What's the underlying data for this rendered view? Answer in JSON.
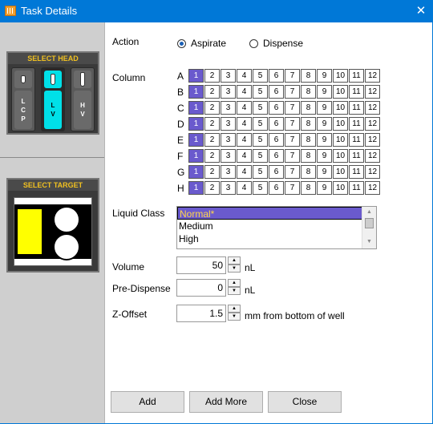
{
  "window": {
    "title": "Task Details",
    "close_glyph": "✕"
  },
  "sidebar": {
    "head_panel_title": "SELECT HEAD",
    "target_panel_title": "SELECT TARGET",
    "heads": [
      {
        "letters": [
          "L",
          "C",
          "P"
        ],
        "selected": false
      },
      {
        "letters": [
          "L",
          "V"
        ],
        "selected": true
      },
      {
        "letters": [
          "H",
          "V"
        ],
        "selected": false
      }
    ],
    "selected_head_color": "#00e0e8",
    "target_color": "#ffff00"
  },
  "action": {
    "label": "Action",
    "options": [
      {
        "label": "Aspirate",
        "selected": true
      },
      {
        "label": "Dispense",
        "selected": false
      }
    ]
  },
  "column": {
    "label": "Column",
    "rows": [
      "A",
      "B",
      "C",
      "D",
      "E",
      "F",
      "G",
      "H"
    ],
    "columns": [
      "1",
      "2",
      "3",
      "4",
      "5",
      "6",
      "7",
      "8",
      "9",
      "10",
      "11",
      "12"
    ],
    "selected_column": "1",
    "selected_color": "#6a5acd"
  },
  "liquid_class": {
    "label": "Liquid Class",
    "options": [
      "Normal*",
      "Medium",
      "High"
    ],
    "selected": "Normal*"
  },
  "volume": {
    "label": "Volume",
    "value": "50",
    "unit": "nL"
  },
  "pre_dispense": {
    "label": "Pre-Dispense",
    "value": "0",
    "unit": "nL"
  },
  "z_offset": {
    "label": "Z-Offset",
    "value": "1.5",
    "unit": "mm from bottom of well"
  },
  "buttons": {
    "add": "Add",
    "add_more": "Add More",
    "close": "Close"
  }
}
